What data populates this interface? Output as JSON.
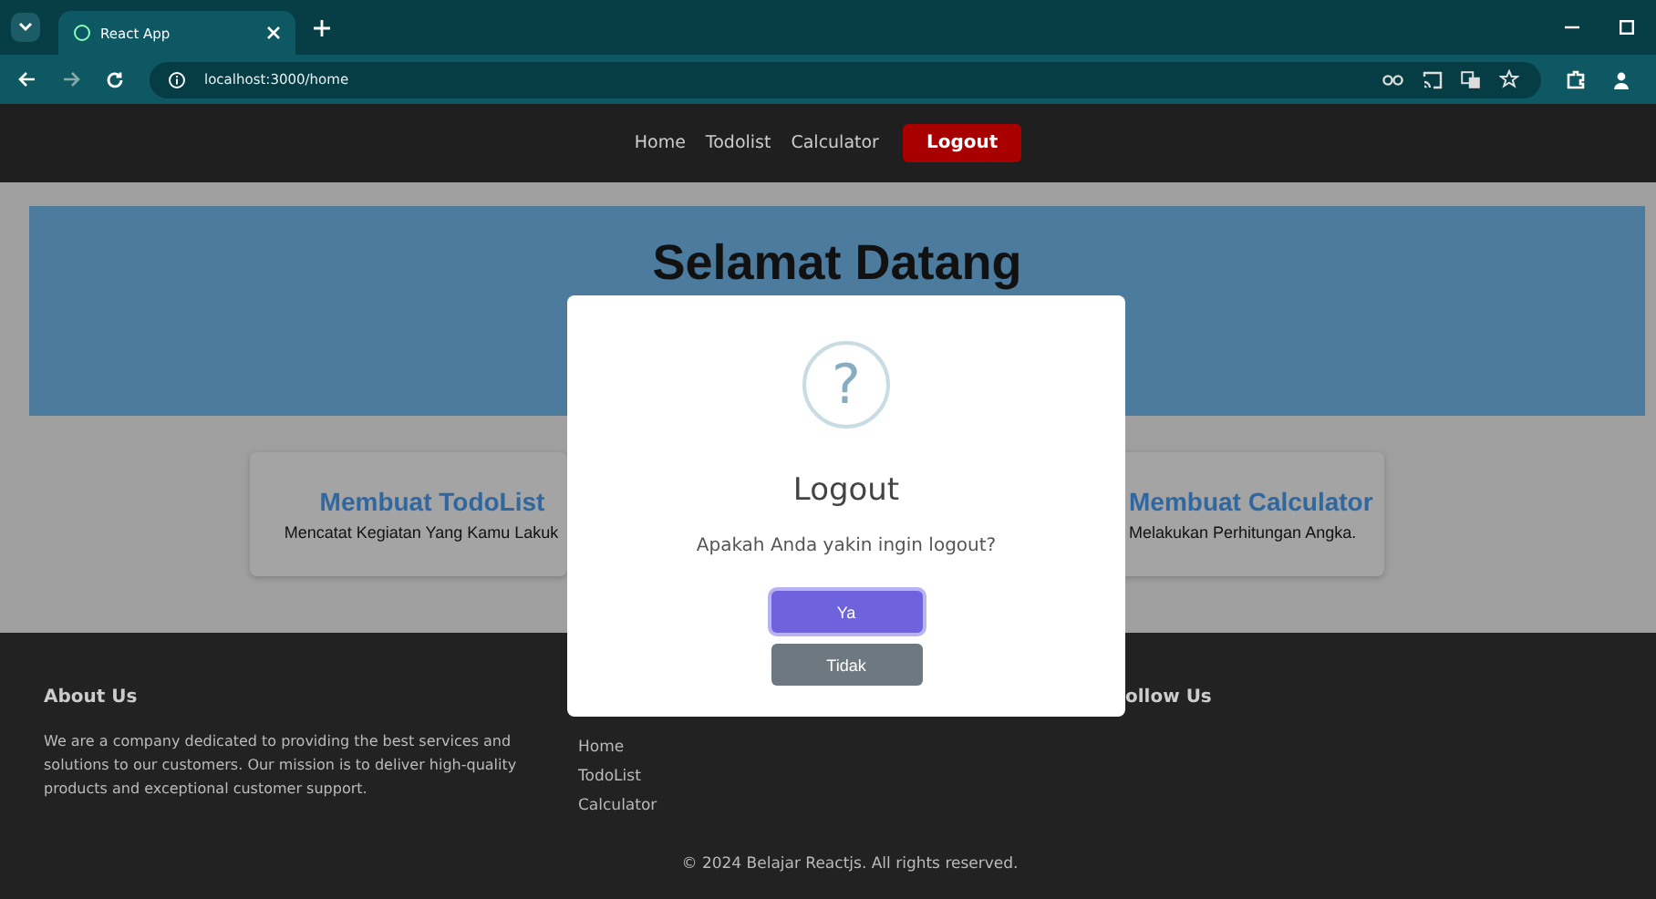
{
  "browser": {
    "tab_title": "React App",
    "url": "localhost:3000/home"
  },
  "nav": {
    "links": [
      {
        "label": "Home"
      },
      {
        "label": "Todolist"
      },
      {
        "label": "Calculator"
      }
    ],
    "logout": "Logout"
  },
  "hero": {
    "title": "Selamat Datang"
  },
  "cards": [
    {
      "title": "Membuat TodoList",
      "description": "Mencatat Kegiatan Yang Kamu Lakuk"
    },
    {
      "title": "Membuat Calculator",
      "description": "Melakukan Perhitungan Angka."
    }
  ],
  "footer": {
    "about": {
      "heading": "About Us",
      "text": "We are a company dedicated to providing the best services and solutions to our customers. Our mission is to deliver high-quality products and exceptional customer support."
    },
    "links": [
      "Home",
      "TodoList",
      "Calculator"
    ],
    "follow": {
      "heading": "ollow Us"
    },
    "copyright": "© 2024 Belajar Reactjs. All rights reserved."
  },
  "modal": {
    "icon": "?",
    "title": "Logout",
    "message": "Apakah Anda yakin ingin logout?",
    "buttons": [
      {
        "label": "Ya",
        "kind": "confirm"
      },
      {
        "label": "Tidak",
        "kind": "cancel"
      }
    ]
  }
}
